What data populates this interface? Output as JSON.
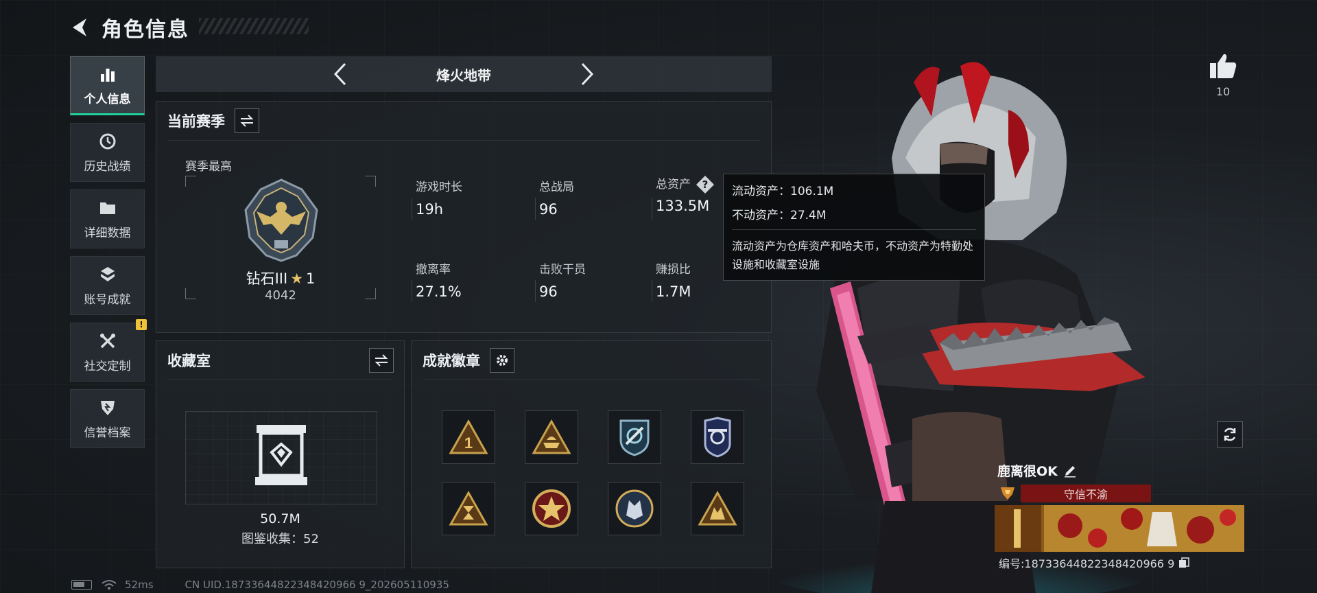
{
  "header": {
    "title": "角色信息"
  },
  "sidebar": {
    "items": [
      {
        "label": "个人信息",
        "active": true
      },
      {
        "label": "历史战绩"
      },
      {
        "label": "详细数据"
      },
      {
        "label": "账号成就"
      },
      {
        "label": "社交定制",
        "warning": "!"
      },
      {
        "label": "信誉档案"
      }
    ]
  },
  "mode": {
    "title": "烽火地带"
  },
  "season": {
    "title": "当前赛季",
    "best_label": "赛季最高",
    "rank_name": "钻石III",
    "rank_stars": "1",
    "rank_score": "4042",
    "stats": [
      {
        "label": "游戏时长",
        "value": "19h"
      },
      {
        "label": "总战局",
        "value": "96"
      },
      {
        "label": "总资产",
        "value": "133.5M",
        "help": "?"
      },
      {
        "label": "撤离率",
        "value": "27.1%"
      },
      {
        "label": "击败干员",
        "value": "96"
      },
      {
        "label": "赚损比",
        "value": "1.7M"
      }
    ]
  },
  "tooltip": {
    "liquid": "流动资产：106.1M",
    "fixed": "不动资产：27.4M",
    "desc": "流动资产为仓库资产和哈夫币，不动资产为特勤处设施和收藏室设施"
  },
  "collection": {
    "title": "收藏室",
    "value": "50.7M",
    "count": "图鉴收集：52"
  },
  "achievements": {
    "title": "成就徽章",
    "badges": [
      "triangle-gold",
      "triangle-ship",
      "shield-blue",
      "badge-blue",
      "hourglass-gold",
      "star-medal",
      "wolf-round",
      "triangle-hands"
    ]
  },
  "likes": {
    "count": "10"
  },
  "player": {
    "name": "鹿离很OK",
    "credit": "守信不渝",
    "uid": "编号:18733644822348420966 9"
  },
  "footer": {
    "ping": "52ms",
    "uid": "CN UID.18733644822348420966 9_202605110935"
  },
  "colors": {
    "accent": "#1fd19a",
    "warning": "#f0c23a",
    "credit": "#7a1414",
    "panel": "#1e2328"
  }
}
